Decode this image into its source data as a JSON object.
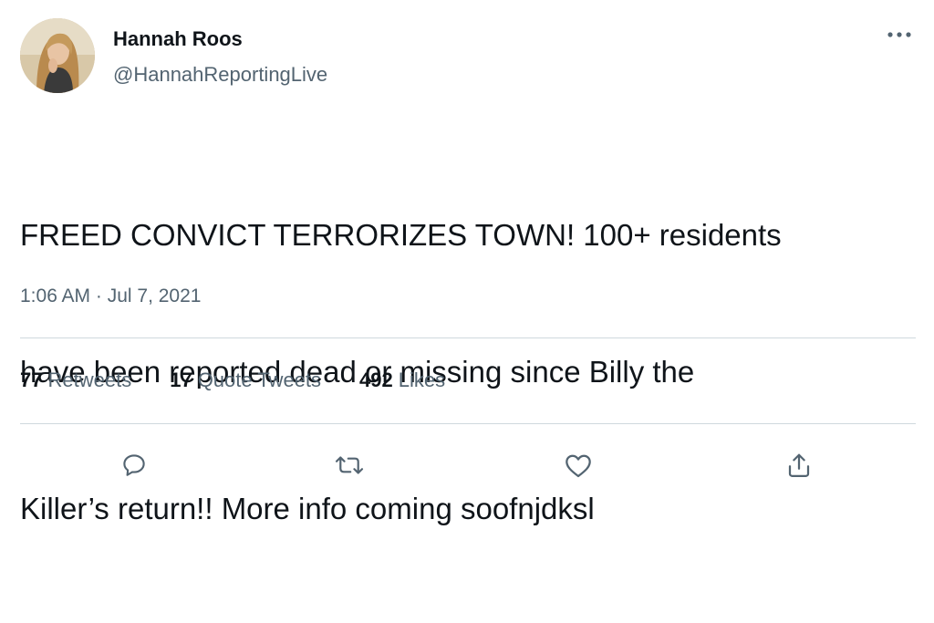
{
  "user": {
    "display_name": "Hannah Roos",
    "handle": "@HannahReportingLive",
    "avatar_icon": "profile-photo"
  },
  "more_icon": "ellipsis-icon",
  "tweet": {
    "text_line_1": "FREED CONVICT TERRORIZES TOWN! 100+ residents",
    "text_line_2": "have been reported dead or missing since Billy the",
    "text_line_3": "Killer’s return!! More info coming soofnjdksl",
    "timestamp": "1:06 AM · Jul 7, 2021"
  },
  "stats": {
    "retweets_count": "77",
    "retweets_label": "Retweets",
    "quotes_count": "17",
    "quotes_label": "Quote Tweets",
    "likes_count": "492",
    "likes_label": "Likes"
  },
  "actions": [
    {
      "icon": "reply-icon"
    },
    {
      "icon": "retweet-icon"
    },
    {
      "icon": "like-heart-icon"
    },
    {
      "icon": "share-icon"
    }
  ],
  "colors": {
    "text_primary": "#0f1419",
    "text_secondary": "#536471",
    "divider": "#cfd9de",
    "icon": "#536471"
  }
}
